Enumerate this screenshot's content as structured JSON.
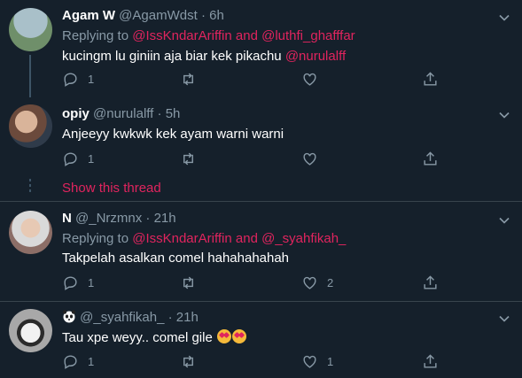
{
  "tweets": [
    {
      "name": "Agam W",
      "handle": "@AgamWdst",
      "time": "6h",
      "replying_label": "Replying to",
      "replying_to_1": "@IssKndarAriffin",
      "replying_and": "and",
      "replying_to_2": "@luthfi_ghafffar",
      "text": "kucingm lu giniin aja biar kek pikachu",
      "mention": "@nurulalff",
      "reply_count": "1",
      "retweet_count": "",
      "like_count": ""
    },
    {
      "name": "opiy",
      "handle": "@nurulalff",
      "time": "5h",
      "text": "Anjeeyy kwkwk kek ayam warni warni",
      "reply_count": "1",
      "retweet_count": "",
      "like_count": ""
    },
    {
      "name": "N",
      "handle": "@_Nrzmnx",
      "time": "21h",
      "replying_label": "Replying to",
      "replying_to_1": "@IssKndarAriffin",
      "replying_and": "and",
      "replying_to_2": "@_syahfikah_",
      "text": "Takpelah asalkan comel hahahahahah",
      "reply_count": "1",
      "retweet_count": "",
      "like_count": "2"
    },
    {
      "name_icon": "panda-emoji-icon",
      "handle": "@_syahfikah_",
      "time": "21h",
      "text": "Tau xpe weyy.. comel gile",
      "emoji_icons": [
        "heart-eyes-emoji-icon",
        "heart-eyes-emoji-icon"
      ],
      "reply_count": "1",
      "retweet_count": "",
      "like_count": "1"
    }
  ],
  "thread": {
    "show_thread_label": "Show this thread"
  },
  "colors": {
    "background": "#15202b",
    "accent": "#e0245e",
    "muted": "#8899a6",
    "divider": "#38444d"
  },
  "dot_separator": "·"
}
